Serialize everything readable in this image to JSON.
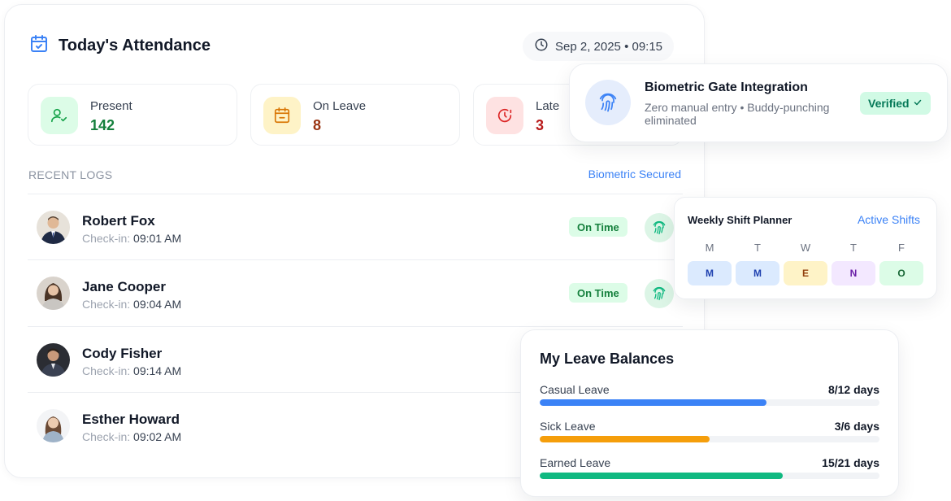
{
  "attendance": {
    "title": "Today's Attendance",
    "datetime": "Sep 2, 2025 • 09:15",
    "stats": [
      {
        "label": "Present",
        "value": "142",
        "color": "#15803d",
        "bg": "#dcfce7",
        "icon": "user-check-icon"
      },
      {
        "label": "On Leave",
        "value": "8",
        "color": "#9a3412",
        "bg": "#fef3c7",
        "icon": "calendar-minus-icon"
      },
      {
        "label": "Late",
        "value": "3",
        "color": "#b91c1c",
        "bg": "#fee2e2",
        "icon": "clock-alert-icon"
      }
    ],
    "logs_heading": "RECENT LOGS",
    "logs_link": "Biometric Secured",
    "checkin_prefix": "Check-in:",
    "logs": [
      {
        "name": "Robert Fox",
        "time": "09:01 AM",
        "status": "On Time"
      },
      {
        "name": "Jane Cooper",
        "time": "09:04 AM",
        "status": "On Time"
      },
      {
        "name": "Cody Fisher",
        "time": "09:14 AM",
        "status": ""
      },
      {
        "name": "Esther Howard",
        "time": "09:02 AM",
        "status": ""
      }
    ]
  },
  "biometric": {
    "title": "Biometric Gate Integration",
    "description": "Zero manual entry • Buddy-punching eliminated",
    "badge": "Verified"
  },
  "shift_planner": {
    "title": "Weekly Shift Planner",
    "link": "Active Shifts",
    "days": [
      "M",
      "T",
      "W",
      "T",
      "F"
    ],
    "shifts": [
      {
        "code": "M",
        "bg": "#dbeafe",
        "color": "#1e40af"
      },
      {
        "code": "M",
        "bg": "#dbeafe",
        "color": "#1e40af"
      },
      {
        "code": "E",
        "bg": "#fef3c7",
        "color": "#92400e"
      },
      {
        "code": "N",
        "bg": "#f3e8ff",
        "color": "#6b21a8"
      },
      {
        "code": "O",
        "bg": "#dcfce7",
        "color": "#166534"
      }
    ]
  },
  "leave_balances": {
    "title": "My Leave Balances",
    "items": [
      {
        "name": "Casual Leave",
        "days": "8/12 days",
        "used": 8,
        "total": 12,
        "color": "#3b82f6"
      },
      {
        "name": "Sick Leave",
        "days": "3/6 days",
        "used": 3,
        "total": 6,
        "color": "#f59e0b"
      },
      {
        "name": "Earned Leave",
        "days": "15/21 days",
        "used": 15,
        "total": 21,
        "color": "#10b981"
      }
    ]
  }
}
